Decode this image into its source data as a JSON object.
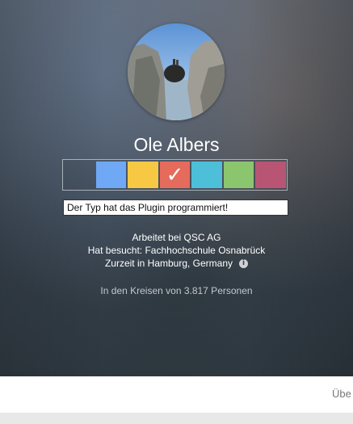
{
  "profile": {
    "name": "Ole Albers",
    "note_value": "Der Typ hat das Plugin programmiert!",
    "works_at": "Arbeitet bei QSC AG",
    "studied": "Hat besucht: Fachhochschule Osnabrück",
    "lives": "Zurzeit in Hamburg, Germany",
    "circles": "In den Kreisen von 3.817 Personen"
  },
  "swatches": [
    {
      "color": "transparent",
      "checked": false
    },
    {
      "color": "#6fa8f5",
      "checked": false
    },
    {
      "color": "#f6c844",
      "checked": false
    },
    {
      "color": "#e56b5d",
      "checked": true
    },
    {
      "color": "#4dbfd9",
      "checked": false
    },
    {
      "color": "#8bc66e",
      "checked": false
    },
    {
      "color": "#b95574",
      "checked": false
    }
  ],
  "icons": {
    "checkmark": "✓",
    "info": "i"
  },
  "footer": {
    "link_label": "Übe"
  }
}
